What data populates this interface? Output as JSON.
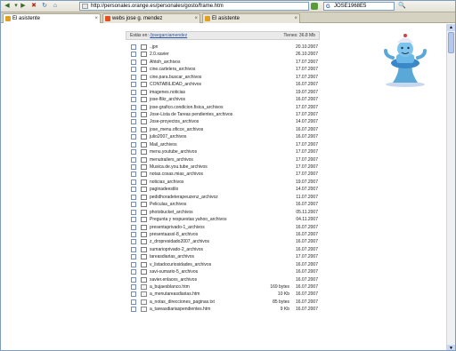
{
  "browser": {
    "url": "http://personales.orange.es/personales/gosto/frame.htm",
    "search_value": "JOSE1968E5",
    "tabs": [
      {
        "label": "El asistente",
        "active": true
      },
      {
        "label": "webs jose g. mendez",
        "active": false
      },
      {
        "label": "El asistente",
        "active": false
      }
    ]
  },
  "path": {
    "prefix": "Estás en:",
    "link": "/josegarciamendez",
    "size_label": "Tienes: 36.8 Mb"
  },
  "files": [
    {
      "name": "..jpn",
      "size": "",
      "date": "20.10.2007",
      "kind": "folder"
    },
    {
      "name": "2.0.xavier",
      "size": "",
      "date": "26.10.2007",
      "kind": "folder"
    },
    {
      "name": "Ahtoh_archivos",
      "size": "",
      "date": "17.07.2007",
      "kind": "folder"
    },
    {
      "name": "cine.cartelera_archivos",
      "size": "",
      "date": "17.07.2007",
      "kind": "folder"
    },
    {
      "name": "cine.para.buscar_archivos",
      "size": "",
      "date": "17.07.2007",
      "kind": "folder"
    },
    {
      "name": "CONTABILIDAD_archivos",
      "size": "",
      "date": "16.07.2007",
      "kind": "folder"
    },
    {
      "name": "imagenes.noticias",
      "size": "",
      "date": "19.07.2007",
      "kind": "folder"
    },
    {
      "name": "jose-flikr_archivos",
      "size": "",
      "date": "16.07.2007",
      "kind": "folder"
    },
    {
      "name": "jose-grafico.condicion.fisica_archivos",
      "size": "",
      "date": "17.07.2007",
      "kind": "folder"
    },
    {
      "name": "Jose-Lista de Tareas pendientes_archivos",
      "size": "",
      "date": "17.07.2007",
      "kind": "folder"
    },
    {
      "name": "Jose-proyectos_archivos",
      "size": "",
      "date": "14.07.2007",
      "kind": "folder"
    },
    {
      "name": "jose_menu.oficce_archivos",
      "size": "",
      "date": "16.07.2007",
      "kind": "folder"
    },
    {
      "name": "julio2007_archivos",
      "size": "",
      "date": "16.07.2007",
      "kind": "folder"
    },
    {
      "name": "Mail_archivos",
      "size": "",
      "date": "17.07.2007",
      "kind": "folder"
    },
    {
      "name": "menu.youtube_archivos",
      "size": "",
      "date": "17.07.2007",
      "kind": "folder"
    },
    {
      "name": "menutrailers_archivos",
      "size": "",
      "date": "17.07.2007",
      "kind": "folder"
    },
    {
      "name": "Musica.de.you.tube_archivos",
      "size": "",
      "date": "17.07.2007",
      "kind": "folder"
    },
    {
      "name": "notas.cosas.mias_archivos",
      "size": "",
      "date": "17.07.2007",
      "kind": "folder"
    },
    {
      "name": "noticias_archivos",
      "size": "",
      "date": "19.07.2007",
      "kind": "folder"
    },
    {
      "name": "paginadeestilo",
      "size": "",
      "date": "14.07.2007",
      "kind": "folder"
    },
    {
      "name": "pedidhoradeterapeuzenz_archivoz",
      "size": "",
      "date": "11.07.2007",
      "kind": "folder"
    },
    {
      "name": "Peliculas_archivos",
      "size": "",
      "date": "16.07.2007",
      "kind": "folder"
    },
    {
      "name": "photobucket_archivos",
      "size": "",
      "date": "05.11.2007",
      "kind": "folder"
    },
    {
      "name": "Pregunta y respuestas yahoo_archivos",
      "size": "",
      "date": "04.11.2007",
      "kind": "folder"
    },
    {
      "name": "presentaprivado-1_archivos",
      "size": "",
      "date": "16.07.2007",
      "kind": "folder"
    },
    {
      "name": "presentaasxl-8_archivos",
      "size": "",
      "date": "16.07.2007",
      "kind": "folder"
    },
    {
      "name": "z_dropresidado2007_archivos",
      "size": "",
      "date": "16.07.2007",
      "kind": "folder"
    },
    {
      "name": "sumarioprivado-2_archivos",
      "size": "",
      "date": "16.07.2007",
      "kind": "folder"
    },
    {
      "name": "tareasdiarias_archivos",
      "size": "",
      "date": "17.07.2007",
      "kind": "folder"
    },
    {
      "name": "v_listadocuriosidades_archivos",
      "size": "",
      "date": "16.07.2007",
      "kind": "folder"
    },
    {
      "name": "xavi-sumario-5_archivos",
      "size": "",
      "date": "16.07.2007",
      "kind": "folder"
    },
    {
      "name": "xavier.enlaces_archivos",
      "size": "",
      "date": "16.07.2007",
      "kind": "folder"
    },
    {
      "name": "a_bujaesblanco.htm",
      "size": "169 bytes",
      "date": "16.07.2007",
      "kind": "file"
    },
    {
      "name": "a_menutareasdiarias.htm",
      "size": "10 Kb",
      "date": "16.07.2007",
      "kind": "file"
    },
    {
      "name": "a_notas_direcciones_paginas.txt",
      "size": "85 bytes",
      "date": "16.07.2007",
      "kind": "file"
    },
    {
      "name": "a_tareasdiariaspendientes.htm",
      "size": "9 Kb",
      "date": "16.07.2007",
      "kind": "file"
    }
  ],
  "colors": {
    "folder_fill": "#ffffff",
    "checkbox_border": "#6f8fb8",
    "link": "#2a55a0"
  },
  "mascot": {
    "icon": "genie-mascot-icon"
  }
}
